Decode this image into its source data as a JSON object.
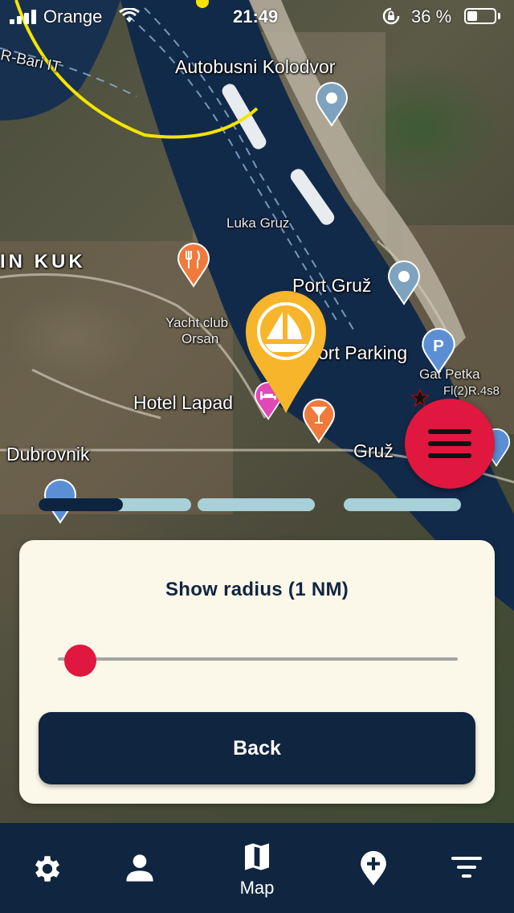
{
  "status_bar": {
    "carrier": "Orange",
    "time": "21:49",
    "battery_percent": "36 %",
    "battery_level": 0.36
  },
  "map": {
    "labels": {
      "bus_station": "Autobusni Kolodvor",
      "ferry_route": "R-Bari IT",
      "luka_gruz": "Luka Gruz",
      "district": "IN KUK",
      "port_gruz": "Port Gruž",
      "yacht_club": "Yacht club",
      "orsan": "Orsan",
      "port_parking": "ort Parking",
      "gat_petka": "Gat Petka",
      "light_char": "Fl(2)R.4s8",
      "hotel_lapad": "Hotel Lapad",
      "dubrovnik": "Dubrovnik",
      "gruz": "Gruž"
    },
    "colors": {
      "radius_circle": "#f5e400",
      "marina_pin": "#f6b52b",
      "restaurant_pin": "#f07a3c",
      "hotel_pin": "#e048b8",
      "parking_pin": "#5a8fd6",
      "info_pin": "#7ea3bf"
    }
  },
  "progress_bars": [
    {
      "value": 0.55
    },
    {
      "value": 0.0
    },
    {
      "value": 0.0
    }
  ],
  "panel": {
    "title": "Show radius (1 NM)",
    "slider_value": 0.0,
    "back_label": "Back",
    "accent": "#e0173e",
    "button_color": "#0f2540"
  },
  "bottom_nav": {
    "items": [
      {
        "icon": "gear-icon",
        "label": ""
      },
      {
        "icon": "person-icon",
        "label": ""
      },
      {
        "icon": "map-icon",
        "label": "Map"
      },
      {
        "icon": "add-location-icon",
        "label": ""
      },
      {
        "icon": "filter-icon",
        "label": ""
      }
    ]
  }
}
